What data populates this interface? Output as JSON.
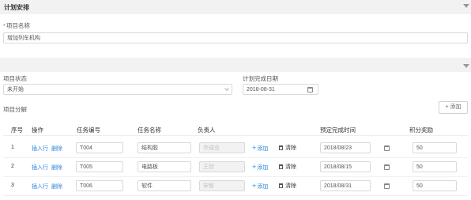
{
  "plan_section": {
    "title": "计划安排"
  },
  "project": {
    "name_label": "项目名称",
    "required_mark": "*",
    "name_value": "增加列车机构"
  },
  "status": {
    "label": "项目状态",
    "value": "未开始",
    "due_label": "计划完成日期",
    "due_value": "2018-08-31"
  },
  "breakdown": {
    "label": "项目分解",
    "add_button": "+ 添加",
    "headers": [
      "序号",
      "操作",
      "任务编号",
      "任务名称",
      "负责人",
      "预定完成时间",
      "积分奖励"
    ],
    "rows": [
      {
        "seq": "1",
        "insert": "插入行",
        "delete": "删除",
        "task_no": "T004",
        "task_name": "结构胶",
        "owner": "齐成业",
        "add": "添加",
        "clear": "清除",
        "due": "2018/08/23",
        "points": "50"
      },
      {
        "seq": "2",
        "insert": "插入行",
        "delete": "删除",
        "task_no": "T005",
        "task_name": "电路板",
        "owner": "王欣",
        "add": "添加",
        "clear": "清除",
        "due": "2018/08/15",
        "points": "50"
      },
      {
        "seq": "3",
        "insert": "插入行",
        "delete": "删除",
        "task_no": "T006",
        "task_name": "软件",
        "owner": "宋智",
        "add": "添加",
        "clear": "清除",
        "due": "2018/08/31",
        "points": "50"
      }
    ]
  },
  "icons": {
    "collapse": "caret-down-icon",
    "calendar": "calendar-icon",
    "clear": "trash-icon",
    "add": "plus-icon"
  }
}
